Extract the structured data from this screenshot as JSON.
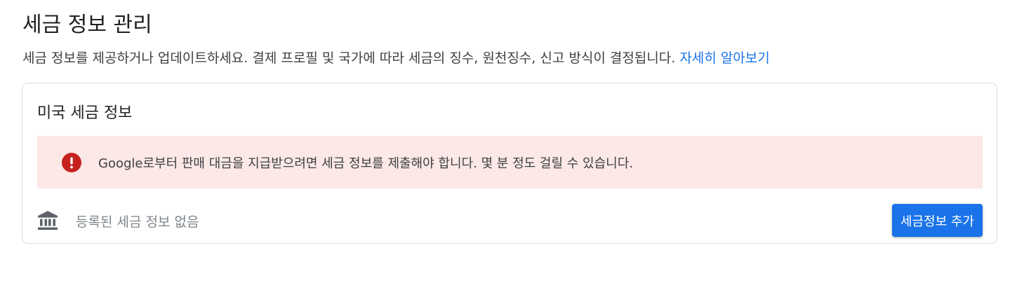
{
  "header": {
    "title": "세금 정보 관리",
    "description": "세금 정보를 제공하거나 업데이트하세요. 결제 프로필 및 국가에 따라 세금의 징수, 원천징수, 신고 방식이 결정됩니다. ",
    "learn_more_link": "자세히 알아보기"
  },
  "card": {
    "title": "미국 세금 정보",
    "alert": {
      "icon": "error-icon",
      "text": "Google로부터 판매 대금을 지급받으려면 세금 정보를 제출해야 합니다. 몇 분 정도 걸릴 수 있습니다."
    },
    "empty_state": {
      "icon": "bank-icon",
      "text": "등록된 세금 정보 없음"
    },
    "add_button_label": "세금정보 추가"
  },
  "colors": {
    "accent": "#1a73e8",
    "error": "#c5221f",
    "alert_background": "#fce8e6",
    "muted_text": "#80868b"
  }
}
